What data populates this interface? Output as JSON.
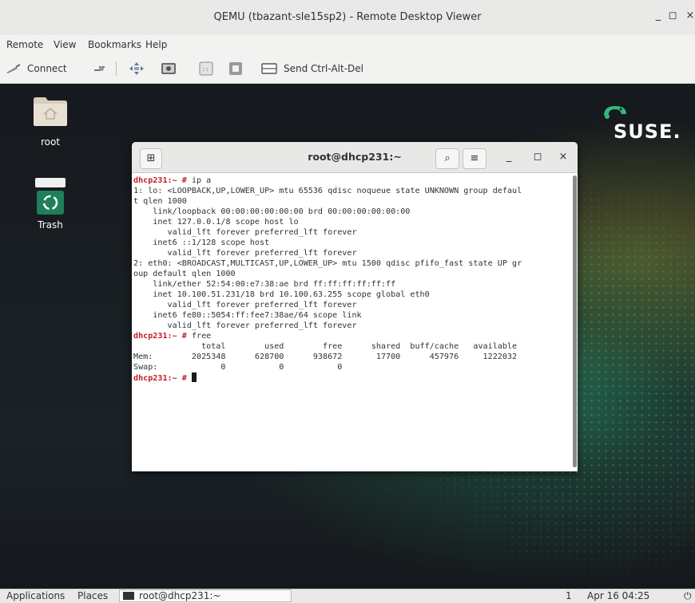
{
  "window": {
    "title": "QEMU (tbazant-sle15sp2) - Remote Desktop Viewer",
    "minimize_glyph": "_",
    "maximize_glyph": "◻",
    "close_glyph": "×"
  },
  "menu": {
    "items": [
      "Remote",
      "View",
      "Bookmarks",
      "Help"
    ]
  },
  "toolbar": {
    "connect_label": "Connect",
    "send_cad_label": "Send Ctrl-Alt-Del",
    "icons": [
      "connect-icon",
      "disconnect-icon",
      "fullscreen-icon",
      "screenshot-icon",
      "scaling-icon",
      "view-only-icon",
      "keyboard-icon"
    ]
  },
  "desktop": {
    "icons": [
      {
        "label": "root",
        "icon": "home-folder-icon"
      },
      {
        "label": "Trash",
        "icon": "trash-icon"
      }
    ],
    "logo_text": "SUSE."
  },
  "terminal": {
    "title": "root@dhcp231:~",
    "new_tab_glyph": "⊞",
    "search_glyph": "⌕",
    "menu_glyph": "≡",
    "minimize_glyph": "_",
    "maximize_glyph": "◻",
    "close_glyph": "×",
    "lines": [
      {
        "p": "dhcp231:~ # ",
        "t": "ip a"
      },
      {
        "p": "",
        "t": "1: lo: <LOOPBACK,UP,LOWER_UP> mtu 65536 qdisc noqueue state UNKNOWN group defaul"
      },
      {
        "p": "",
        "t": "t qlen 1000"
      },
      {
        "p": "",
        "t": "    link/loopback 00:00:00:00:00:00 brd 00:00:00:00:00:00"
      },
      {
        "p": "",
        "t": "    inet 127.0.0.1/8 scope host lo"
      },
      {
        "p": "",
        "t": "       valid_lft forever preferred_lft forever"
      },
      {
        "p": "",
        "t": "    inet6 ::1/128 scope host"
      },
      {
        "p": "",
        "t": "       valid_lft forever preferred_lft forever"
      },
      {
        "p": "",
        "t": "2: eth0: <BROADCAST,MULTICAST,UP,LOWER_UP> mtu 1500 qdisc pfifo_fast state UP gr"
      },
      {
        "p": "",
        "t": "oup default qlen 1000"
      },
      {
        "p": "",
        "t": "    link/ether 52:54:00:e7:38:ae brd ff:ff:ff:ff:ff:ff"
      },
      {
        "p": "",
        "t": "    inet 10.100.51.231/18 brd 10.100.63.255 scope global eth0"
      },
      {
        "p": "",
        "t": "       valid_lft forever preferred_lft forever"
      },
      {
        "p": "",
        "t": "    inet6 fe80::5054:ff:fee7:38ae/64 scope link"
      },
      {
        "p": "",
        "t": "       valid_lft forever preferred_lft forever"
      },
      {
        "p": "dhcp231:~ # ",
        "t": "free"
      },
      {
        "p": "",
        "t": "              total        used        free      shared  buff/cache   available"
      },
      {
        "p": "",
        "t": "Mem:        2025348      628700      938672       17700      457976     1222032"
      },
      {
        "p": "",
        "t": "Swap:             0           0           0"
      },
      {
        "p": "dhcp231:~ # ",
        "t": "",
        "cursor": true
      }
    ]
  },
  "taskbar": {
    "applications_label": "Applications",
    "places_label": "Places",
    "window_label": "root@dhcp231:~",
    "workspace": "1",
    "clock": "Apr 16 04:25",
    "power_glyph": "⏻"
  }
}
